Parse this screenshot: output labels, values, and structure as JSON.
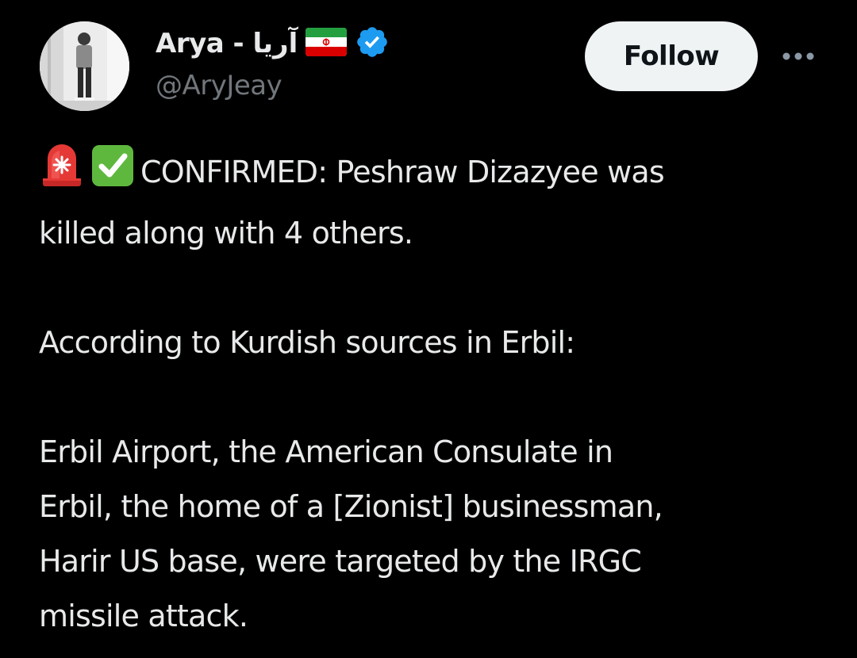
{
  "author": {
    "display_name": "Arya - آریا",
    "handle": "@AryJeay",
    "flag_icon": "iran-flag-icon",
    "verified_icon": "verified-badge-icon",
    "verified_color": "#1d9bf0"
  },
  "actions": {
    "follow_label": "Follow",
    "more_icon": "more-horizontal-icon"
  },
  "post": {
    "emojis": [
      "police-light-emoji",
      "check-mark-emoji"
    ],
    "paragraphs": [
      {
        "lines": [
          "CONFIRMED: Peshraw Dizazyee was",
          "killed along with 4 others."
        ]
      },
      {
        "lines": [
          "According to Kurdish sources in Erbil:"
        ]
      },
      {
        "lines": [
          "Erbil Airport, the American Consulate in",
          "Erbil, the home of a [Zionist] businessman,",
          "Harir US base, were targeted by the IRGC",
          "missile attack."
        ]
      }
    ]
  },
  "colors": {
    "background": "#000000",
    "text_primary": "#e7e9ea",
    "text_secondary": "#71767b",
    "follow_bg": "#eff3f4"
  }
}
